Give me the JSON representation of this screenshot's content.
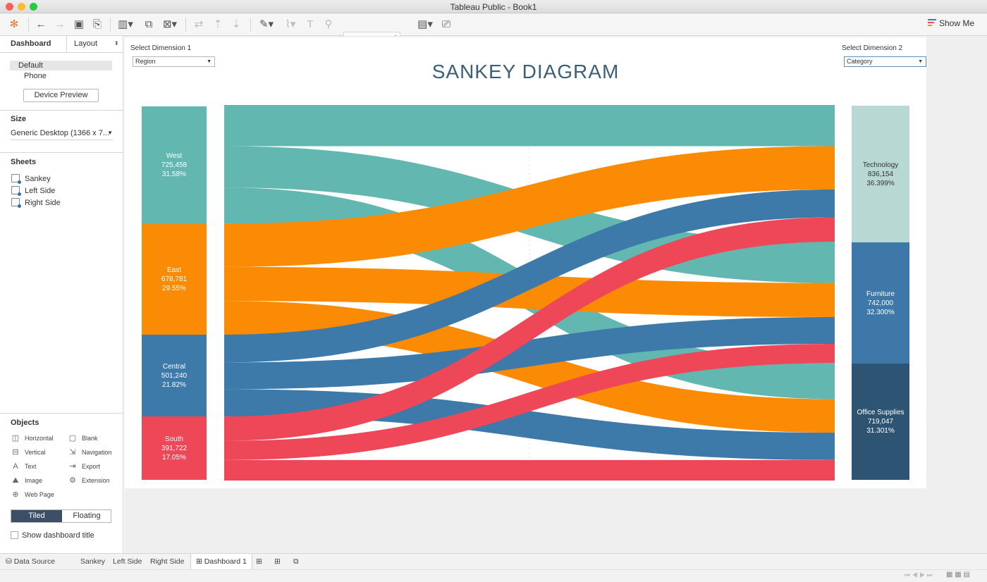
{
  "window": {
    "title": "Tableau Public - Book1"
  },
  "toolbar": {
    "show_me_label": "Show Me",
    "icons": [
      "tableau-logo-icon",
      "undo-icon",
      "redo-icon",
      "save-icon",
      "new-data-source-icon",
      "new-worksheet-icon",
      "duplicate-icon",
      "clear-icon",
      "swap-icon",
      "sort-ascending-icon",
      "sort-descending-icon",
      "highlight-icon",
      "annotate-icon",
      "text-icon",
      "pin-icon",
      "fit-dropdown",
      "show-cards-icon",
      "presentation-icon"
    ]
  },
  "sidebar": {
    "tabs": {
      "dashboard": "Dashboard",
      "layout": "Layout"
    },
    "devices": {
      "default": "Default",
      "phone": "Phone",
      "preview_button": "Device Preview"
    },
    "size": {
      "title": "Size",
      "value": "Generic Desktop (1366 x 7..."
    },
    "sheets": {
      "title": "Sheets",
      "items": [
        "Sankey",
        "Left Side",
        "Right Side"
      ]
    },
    "objects": {
      "title": "Objects",
      "items": [
        {
          "label": "Horizontal",
          "icon": "horizontal-icon"
        },
        {
          "label": "Blank",
          "icon": "blank-icon"
        },
        {
          "label": "Vertical",
          "icon": "vertical-icon"
        },
        {
          "label": "Navigation",
          "icon": "navigation-icon"
        },
        {
          "label": "Text",
          "icon": "text-icon"
        },
        {
          "label": "Export",
          "icon": "export-icon"
        },
        {
          "label": "Image",
          "icon": "image-icon"
        },
        {
          "label": "Extension",
          "icon": "extension-icon"
        },
        {
          "label": "Web Page",
          "icon": "web-page-icon"
        }
      ]
    },
    "mode": {
      "tiled": "Tiled",
      "floating": "Floating"
    },
    "show_title_label": "Show dashboard title"
  },
  "dashboard": {
    "dim1": {
      "label": "Select Dimension 1",
      "value": "Region"
    },
    "dim2": {
      "label": "Select Dimension 2",
      "value": "Category"
    },
    "title": "SANKEY DIAGRAM"
  },
  "colors": {
    "teal": "#62b8b0",
    "orange": "#fb8a04",
    "blue": "#3d79a9",
    "red": "#ee4758",
    "light_teal": "#b8d9d3",
    "mid_blue": "#3d78a8",
    "navy": "#2d5473"
  },
  "chart_data": {
    "type": "sankey",
    "title": "SANKEY DIAGRAM",
    "left_nodes": [
      {
        "name": "West",
        "value": "725,458",
        "pct": "31.58%"
      },
      {
        "name": "East",
        "value": "678,781",
        "pct": "29.55%"
      },
      {
        "name": "Central",
        "value": "501,240",
        "pct": "21.82%"
      },
      {
        "name": "South",
        "value": "391,722",
        "pct": "17.05%"
      }
    ],
    "right_nodes": [
      {
        "name": "Technology",
        "value": "836,154",
        "pct": "36.399%"
      },
      {
        "name": "Furniture",
        "value": "742,000",
        "pct": "32.300%"
      },
      {
        "name": "Office Supplies",
        "value": "719,047",
        "pct": "31.301%"
      }
    ],
    "links": [
      {
        "source": "West",
        "target": "Technology",
        "value": 251991
      },
      {
        "source": "West",
        "target": "Furniture",
        "value": 252613
      },
      {
        "source": "West",
        "target": "Office Supplies",
        "value": 220854
      },
      {
        "source": "East",
        "target": "Technology",
        "value": 264974
      },
      {
        "source": "East",
        "target": "Furniture",
        "value": 208291
      },
      {
        "source": "East",
        "target": "Office Supplies",
        "value": 205516
      },
      {
        "source": "Central",
        "target": "Technology",
        "value": 170416
      },
      {
        "source": "Central",
        "target": "Furniture",
        "value": 163797
      },
      {
        "source": "Central",
        "target": "Office Supplies",
        "value": 167026
      },
      {
        "source": "South",
        "target": "Technology",
        "value": 148772
      },
      {
        "source": "South",
        "target": "Furniture",
        "value": 117299
      },
      {
        "source": "South",
        "target": "Office Supplies",
        "value": 125651
      }
    ]
  },
  "bottom_tabs": {
    "data_source": "Data Source",
    "sheets": [
      "Sankey",
      "Left Side",
      "Right Side"
    ],
    "active": "Dashboard 1"
  }
}
